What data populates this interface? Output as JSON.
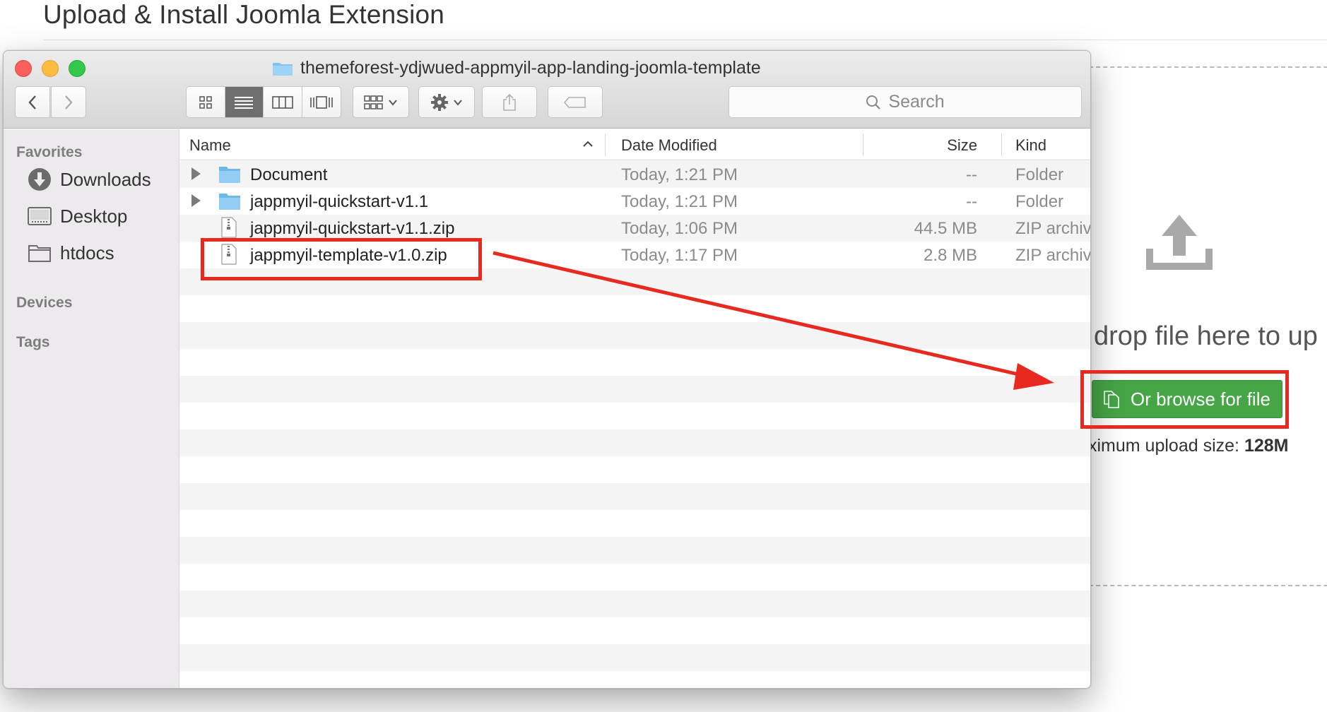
{
  "page": {
    "title": "Upload & Install Joomla Extension",
    "drop_text": "drop file here to up",
    "browse_button": "Or browse for file",
    "upload_size_prefix": "ximum upload size: ",
    "upload_size_value": "128M",
    "accent_green": "#46a546"
  },
  "finder": {
    "window_title": "themeforest-ydjwued-appmyil-app-landing-joomla-template",
    "search_placeholder": "Search",
    "sidebar": {
      "favorites_heading": "Favorites",
      "items": [
        {
          "label": "Downloads",
          "icon": "downloads-icon"
        },
        {
          "label": "Desktop",
          "icon": "desktop-icon"
        },
        {
          "label": "htdocs",
          "icon": "folder-icon"
        }
      ],
      "devices_heading": "Devices",
      "tags_heading": "Tags"
    },
    "columns": {
      "name": "Name",
      "date": "Date Modified",
      "size": "Size",
      "kind": "Kind"
    },
    "files": [
      {
        "name": "Document",
        "date": "Today, 1:21 PM",
        "size": "--",
        "kind": "Folder",
        "type": "folder"
      },
      {
        "name": "jappmyil-quickstart-v1.1",
        "date": "Today, 1:21 PM",
        "size": "--",
        "kind": "Folder",
        "type": "folder"
      },
      {
        "name": "jappmyil-quickstart-v1.1.zip",
        "date": "Today, 1:06 PM",
        "size": "44.5 MB",
        "kind": "ZIP archiv",
        "type": "zip"
      },
      {
        "name": "jappmyil-template-v1.0.zip",
        "date": "Today, 1:17 PM",
        "size": "2.8 MB",
        "kind": "ZIP archiv",
        "type": "zip"
      }
    ]
  },
  "annotation_color": "#e8291f"
}
